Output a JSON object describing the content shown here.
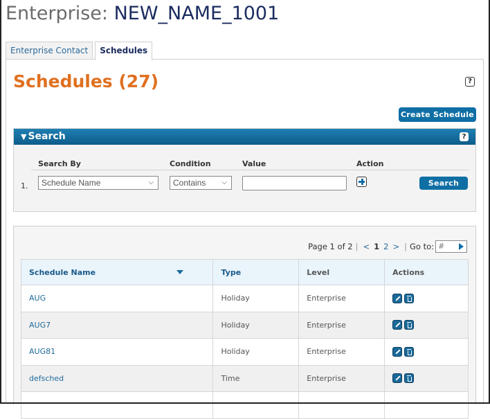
{
  "header": {
    "label": "Enterprise:",
    "name": "NEW_NAME_1001"
  },
  "tabs": [
    {
      "label": "Enterprise Contact",
      "active": false
    },
    {
      "label": "Schedules",
      "active": true
    }
  ],
  "section": {
    "title": "Schedules (27)",
    "help_icon": "?",
    "create_button": "Create Schedule"
  },
  "search": {
    "title": "Search",
    "help_icon": "?",
    "columns": {
      "search_by": "Search By",
      "condition": "Condition",
      "value": "Value",
      "action": "Action"
    },
    "row_number": "1.",
    "search_by_value": "Schedule Name",
    "condition_value": "Contains",
    "value_input": "",
    "search_button": "Search"
  },
  "pager": {
    "text": "Page 1 of 2",
    "sep": "|",
    "prev": "<",
    "current": "1",
    "next_page": "2",
    "next": ">",
    "goto_label": "Go to:",
    "goto_placeholder": "#"
  },
  "table": {
    "columns": [
      "Schedule Name",
      "Type",
      "Level",
      "Actions"
    ],
    "rows": [
      {
        "name": "AUG",
        "type": "Holiday",
        "level": "Enterprise"
      },
      {
        "name": "AUG7",
        "type": "Holiday",
        "level": "Enterprise"
      },
      {
        "name": "AUG81",
        "type": "Holiday",
        "level": "Enterprise"
      },
      {
        "name": "defsched",
        "type": "Time",
        "level": "Enterprise"
      }
    ]
  },
  "colors": {
    "accent": "#0f6fa5",
    "title_orange": "#e07020",
    "header_navy": "#1a2b5e"
  }
}
